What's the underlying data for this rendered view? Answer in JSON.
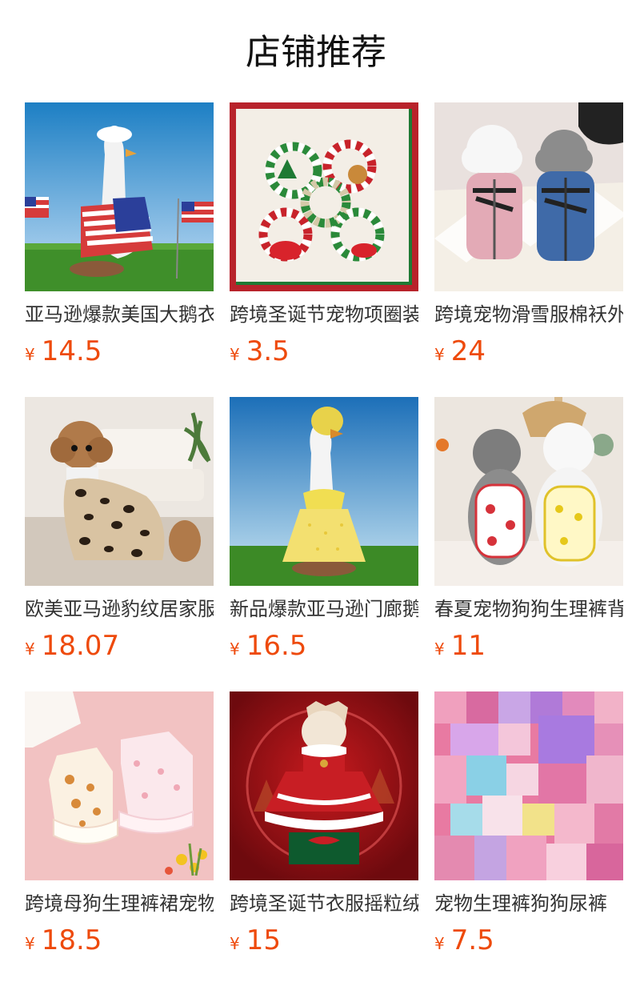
{
  "section": {
    "title": "店铺推荐"
  },
  "currency_symbol": "¥",
  "products": [
    {
      "name": "亚马逊爆款美国大鹅衣服",
      "price": "14.5",
      "image": "goose-usa-outfit"
    },
    {
      "name": "跨境圣诞节宠物项圈装饰",
      "price": "3.5",
      "image": "christmas-collars"
    },
    {
      "name": "跨境宠物滑雪服棉袄外套",
      "price": "24",
      "image": "dogs-ski-jackets"
    },
    {
      "name": "欧美亚马逊豹纹居家服",
      "price": "18.07",
      "image": "leopard-dog-pajamas"
    },
    {
      "name": "新品爆款亚马逊门廊鹅衣服",
      "price": "16.5",
      "image": "goose-yellow-dress"
    },
    {
      "name": "春夏宠物狗狗生理裤背带",
      "price": "11",
      "image": "dogs-strawberry-diapers"
    },
    {
      "name": "跨境母狗生理裤裙宠物",
      "price": "18.5",
      "image": "floral-dog-dresses"
    },
    {
      "name": "跨境圣诞节衣服摇粒绒",
      "price": "15",
      "image": "christmas-dog-dress"
    },
    {
      "name": "宠物生理裤狗狗尿裤",
      "price": "7.5",
      "image": "pink-pet-pants"
    }
  ]
}
